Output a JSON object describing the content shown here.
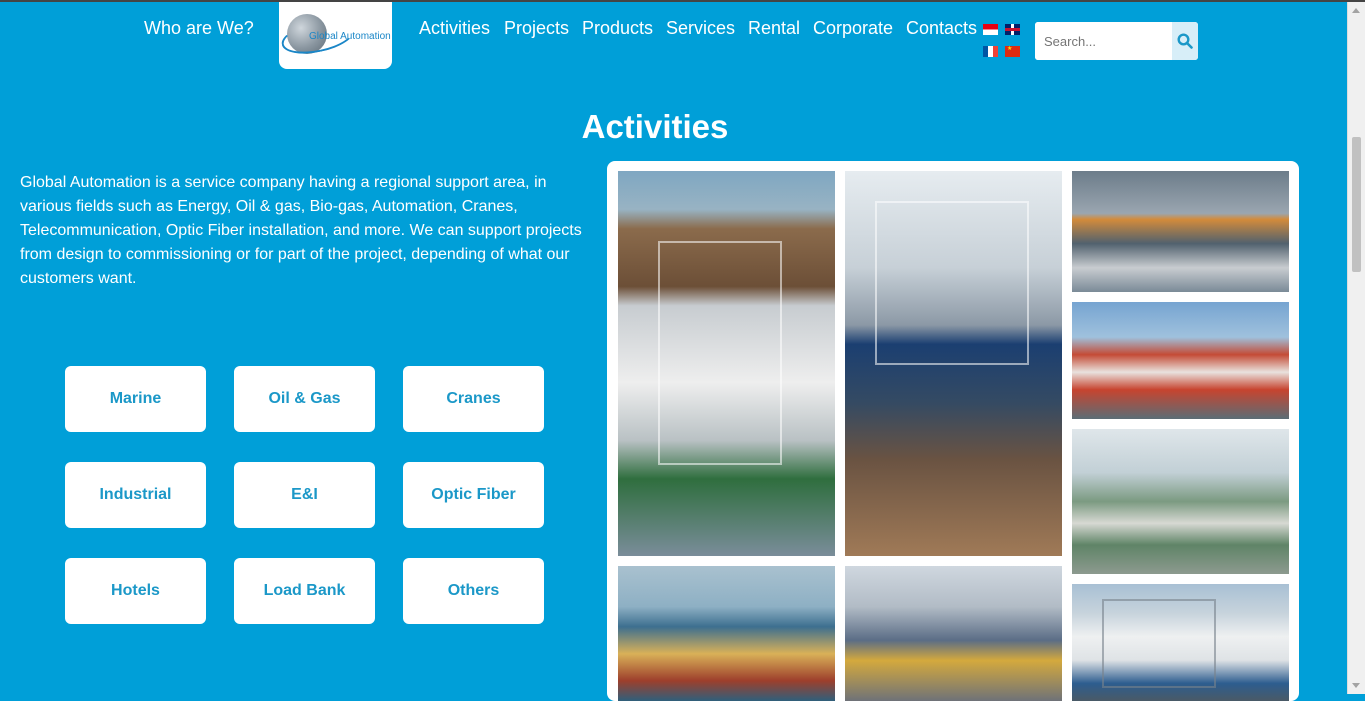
{
  "nav": {
    "who": "Who are We?",
    "logo_text": "Global Automation",
    "items": [
      "Activities",
      "Projects",
      "Products",
      "Services",
      "Rental",
      "Corporate",
      "Contacts"
    ]
  },
  "languages": [
    "Indonesian",
    "English",
    "French",
    "Chinese"
  ],
  "search": {
    "placeholder": "Search..."
  },
  "page": {
    "title": "Activities",
    "intro": "Global Automation is a service company having a regional support area, in various fields such as Energy, Oil & gas, Bio-gas, Automation, Cranes, Telecommunication, Optic Fiber installation, and more. We can support projects from design to commissioning or for part of the project, depending of what our customers want."
  },
  "categories": [
    "Marine",
    "Oil & Gas",
    "Cranes",
    "Industrial",
    "E&I",
    "Optic Fiber",
    "Hotels",
    "Load Bank",
    "Others"
  ],
  "colors": {
    "background": "#009fd8",
    "button_text": "#1b98c8",
    "logo_blue": "#1a86c7"
  },
  "icons": {
    "search": "search-icon"
  }
}
